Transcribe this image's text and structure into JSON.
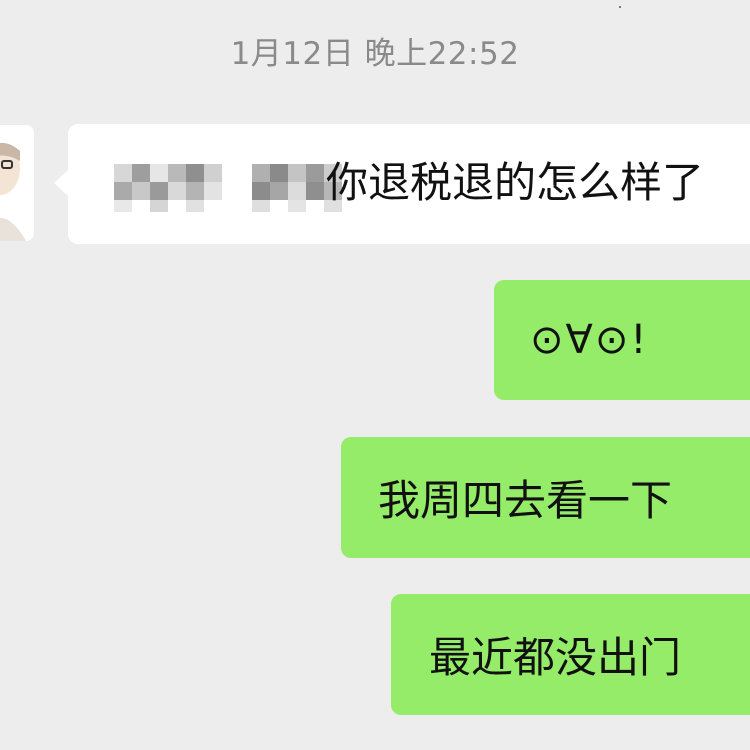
{
  "chat": {
    "timestamp": "1月12日 晚上22:52",
    "incoming": {
      "sender_name": "",
      "text": "你退税退的怎么样了"
    },
    "outgoing": [
      {
        "text": "⊙∀⊙!"
      },
      {
        "text": "我周四去看一下"
      },
      {
        "text": "最近都没出门"
      }
    ]
  },
  "colors": {
    "background": "#ededed",
    "incoming_bubble": "#ffffff",
    "outgoing_bubble": "#95ec69",
    "timestamp_text": "#8a8a8a"
  }
}
